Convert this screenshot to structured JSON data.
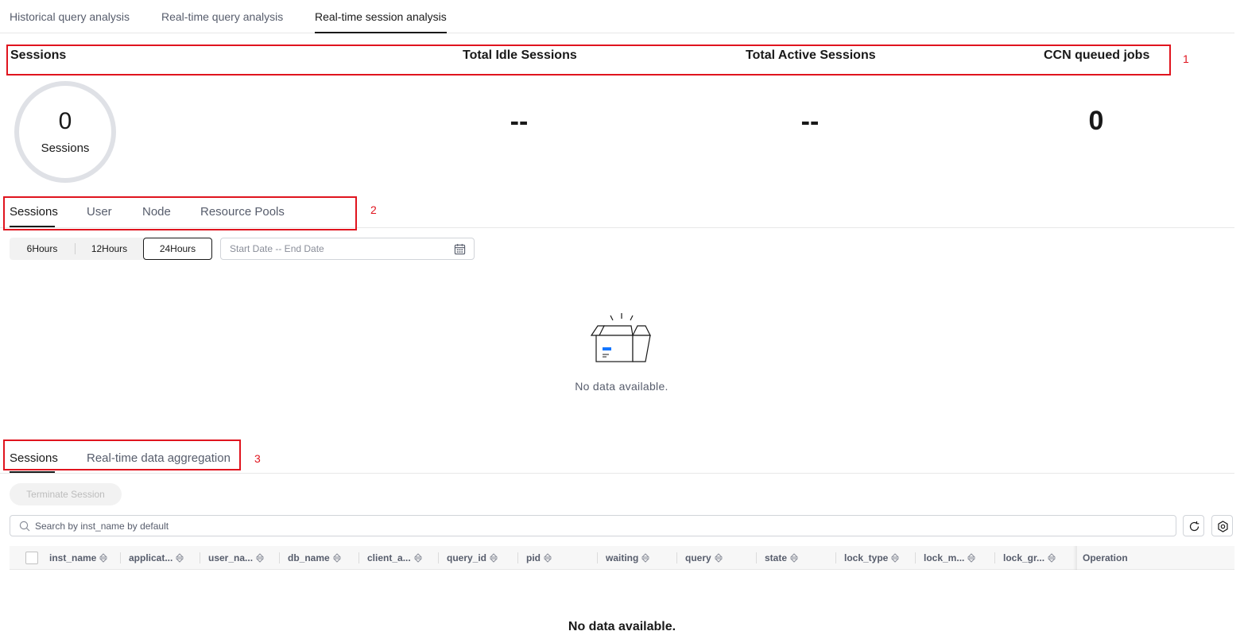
{
  "top_tabs": [
    "Historical query analysis",
    "Real-time query analysis",
    "Real-time session analysis"
  ],
  "top_tab_active": "Real-time session analysis",
  "annotations": [
    "1",
    "2",
    "3"
  ],
  "stats": {
    "sessions_title": "Sessions",
    "idle_title": "Total Idle Sessions",
    "active_title": "Total Active Sessions",
    "ccn_title": "CCN queued jobs",
    "sessions_value": "0",
    "sessions_label": "Sessions",
    "idle_value": "--",
    "active_value": "--",
    "ccn_value": "0"
  },
  "chart_tabs": [
    "Sessions",
    "User",
    "Node",
    "Resource Pools"
  ],
  "chart_tab_active": "Sessions",
  "time_ranges": [
    "6Hours",
    "12Hours",
    "24Hours"
  ],
  "time_range_active": "24Hours",
  "date_placeholder": "Start Date -- End Date",
  "chart_empty": "No data available.",
  "table_tabs": [
    "Sessions",
    "Real-time data aggregation"
  ],
  "table_tab_active": "Sessions",
  "terminate_button": "Terminate Session",
  "search_placeholder": "Search by inst_name by default",
  "columns": [
    "inst_name",
    "applicat...",
    "user_na...",
    "db_name",
    "client_a...",
    "query_id",
    "pid",
    "waiting",
    "query",
    "state",
    "lock_type",
    "lock_m...",
    "lock_gr...",
    "Operation"
  ],
  "table_empty": "No data available.",
  "colors": {
    "annotation": "#e0141e",
    "accent": "#1476ff",
    "text": "#191919",
    "muted": "#575d6c"
  },
  "icons": [
    "calendar-icon",
    "empty-box-icon",
    "search-icon",
    "refresh-icon",
    "settings-icon",
    "sort-icon"
  ]
}
